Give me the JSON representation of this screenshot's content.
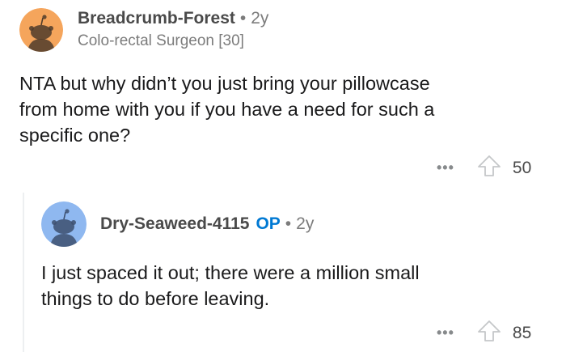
{
  "comment": {
    "username": "Breadcrumb-Forest",
    "separator": "•",
    "age": "2y",
    "flair": "Colo-rectal Surgeon [30]",
    "text_lines": [
      "NTA but why didn’t you just bring your pillowcase",
      "from home with you if you have a need for such a",
      "specific one?"
    ],
    "more_label": "•••",
    "score": "50",
    "avatar_color": "#f5a55c"
  },
  "reply": {
    "username": "Dry-Seaweed-4115",
    "op_badge": "OP",
    "separator": "•",
    "age": "2y",
    "text_lines": [
      "I just spaced it out; there were a million small",
      "things to do before leaving."
    ],
    "more_label": "•••",
    "score": "85",
    "avatar_color": "#8fb8f0"
  },
  "icons": {
    "avatar": "reddit-snoo-icon",
    "upvote": "upvote-arrow-icon",
    "more": "more-options-icon"
  }
}
